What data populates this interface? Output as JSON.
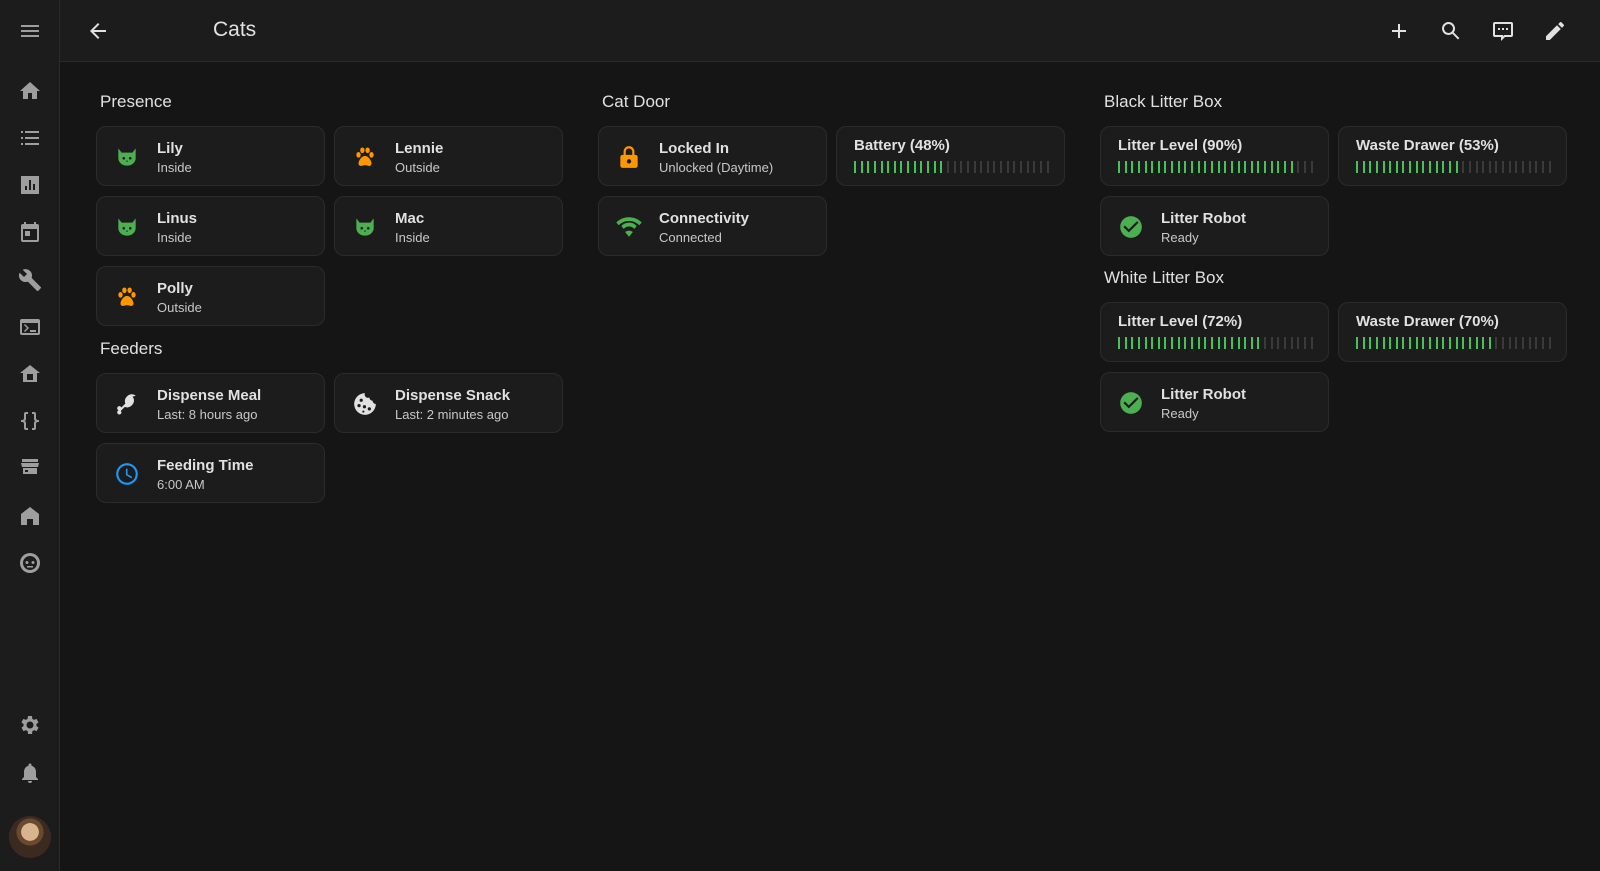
{
  "window": {
    "title": "Cats"
  },
  "colors": {
    "cat_inside": "#4caf50",
    "cat_outside": "#ff9800",
    "lock": "#ff9800",
    "wifi": "#4caf50",
    "clock": "#2196f3",
    "gauge_on": "#43c35a",
    "ready": "#4caf50"
  },
  "sidebar": {
    "items": [
      {
        "icon": "menu-icon"
      },
      {
        "icon": "home-icon"
      },
      {
        "icon": "list-icon"
      },
      {
        "icon": "bar-chart-icon"
      },
      {
        "icon": "calendar-icon"
      },
      {
        "icon": "wrench-icon"
      },
      {
        "icon": "terminal-icon"
      },
      {
        "icon": "database-home-icon"
      },
      {
        "icon": "code-braces-icon"
      },
      {
        "icon": "hacs-store-icon"
      },
      {
        "icon": "home-alt-icon"
      },
      {
        "icon": "robot-icon"
      },
      {
        "icon": "gear-icon"
      },
      {
        "icon": "bell-icon"
      },
      {
        "icon": "user-avatar"
      }
    ]
  },
  "toolbar": {
    "actions": [
      "plus-icon",
      "search-icon",
      "chat-icon",
      "pencil-icon"
    ]
  },
  "sections": {
    "presence": {
      "title": "Presence",
      "cards": [
        {
          "name": "Lily",
          "state": "Inside",
          "icon": "cat-icon"
        },
        {
          "name": "Lennie",
          "state": "Outside",
          "icon": "paw-icon"
        },
        {
          "name": "Linus",
          "state": "Inside",
          "icon": "cat-icon"
        },
        {
          "name": "Mac",
          "state": "Inside",
          "icon": "cat-icon"
        },
        {
          "name": "Polly",
          "state": "Outside",
          "icon": "paw-icon"
        }
      ]
    },
    "feeders": {
      "title": "Feeders",
      "cards": [
        {
          "name": "Dispense Meal",
          "state": "Last: 8 hours ago",
          "icon": "food-drumstick-icon"
        },
        {
          "name": "Dispense Snack",
          "state": "Last: 2 minutes ago",
          "icon": "cookie-icon"
        },
        {
          "name": "Feeding Time",
          "state": "6:00 AM",
          "icon": "clock-icon"
        }
      ]
    },
    "cat_door": {
      "title": "Cat Door",
      "locked": {
        "name": "Locked In",
        "state": "Unlocked (Daytime)",
        "icon": "lock-icon"
      },
      "battery": {
        "label": "Battery (48%)",
        "value": 0.48
      },
      "connectivity": {
        "name": "Connectivity",
        "state": "Connected",
        "icon": "wifi-icon"
      }
    },
    "black_litter_box": {
      "title": "Black Litter Box",
      "litter_level": {
        "label": "Litter Level (90%)",
        "value": 0.9
      },
      "waste_drawer": {
        "label": "Waste Drawer (53%)",
        "value": 0.53
      },
      "robot": {
        "name": "Litter Robot",
        "state": "Ready",
        "icon": "check-circle-icon"
      }
    },
    "white_litter_box": {
      "title": "White Litter Box",
      "litter_level": {
        "label": "Litter Level (72%)",
        "value": 0.72
      },
      "waste_drawer": {
        "label": "Waste Drawer (70%)",
        "value": 0.7
      },
      "robot": {
        "name": "Litter Robot",
        "state": "Ready",
        "icon": "check-circle-icon"
      }
    }
  }
}
